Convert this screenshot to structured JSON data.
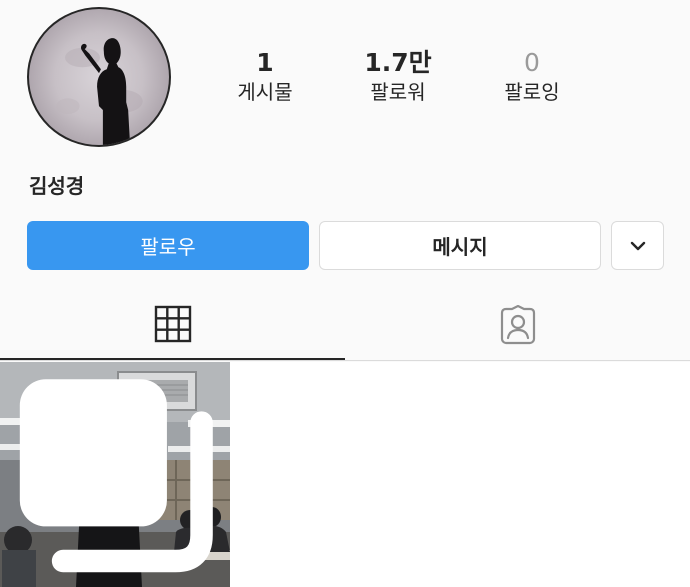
{
  "profile": {
    "name": "김성경",
    "stats": [
      {
        "value": "1",
        "label": "게시물"
      },
      {
        "value": "1.7만",
        "label": "팔로워"
      },
      {
        "value": "0",
        "label": "팔로잉"
      }
    ]
  },
  "actions": {
    "follow_label": "팔로우",
    "message_label": "메시지",
    "more_icon": "chevron-down-icon"
  },
  "tabs": [
    {
      "icon": "grid-icon",
      "active": true
    },
    {
      "icon": "tagged-person-icon",
      "active": false
    }
  ],
  "colors": {
    "accent": "#3897f0",
    "text": "#262626",
    "border": "#dbdbdb",
    "background": "#fafafa"
  },
  "posts": [
    {
      "type": "multi-photo",
      "icon": "multiple-photos-icon"
    }
  ]
}
